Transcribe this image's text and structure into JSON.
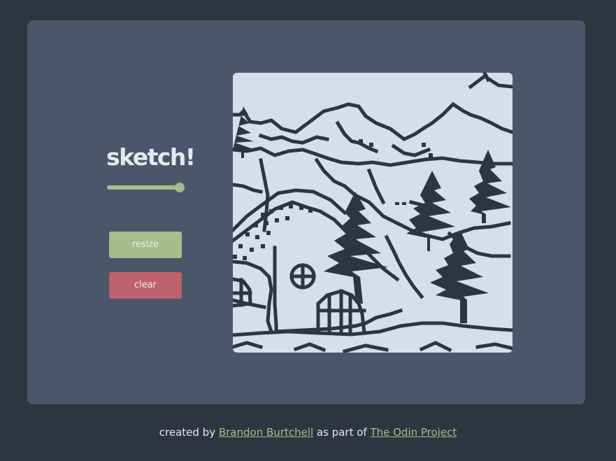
{
  "app": {
    "title": "sketch!"
  },
  "controls": {
    "size_slider_level": 1.0,
    "resize_label": "resize",
    "clear_label": "clear"
  },
  "footer": {
    "prefix": "created by ",
    "author_link": "Brandon Burtchell",
    "middle": " as part of ",
    "project_link": "The Odin Project"
  },
  "colors": {
    "background": "#2e3440",
    "panel": "#4b566b",
    "accent_green": "#a3be8c",
    "accent_red": "#bf616a",
    "canvas": "#d8dee9",
    "ink": "#2e3440",
    "text": "#e5e9f0"
  }
}
